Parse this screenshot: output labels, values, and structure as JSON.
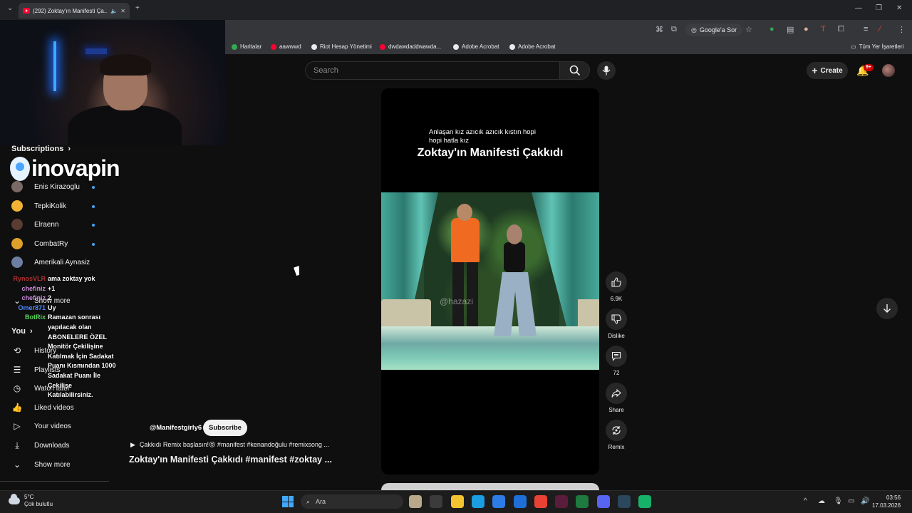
{
  "browser": {
    "tab_title": "(292) Zoktay'ın Manifesti Ça...",
    "ask_google": "Google'a Sor",
    "bookmarks": [
      {
        "label": "Haritalar",
        "color": "#34a853"
      },
      {
        "label": "aawwwd",
        "color": "#ff0033"
      },
      {
        "label": "Riot Hesap Yönetimi",
        "color": "#e8eaed"
      },
      {
        "label": "dwdawdaddwawda...",
        "color": "#ff0033"
      },
      {
        "label": "Adobe Acrobat",
        "color": "#e8eaed"
      },
      {
        "label": "Adobe Acrobat",
        "color": "#e8eaed"
      }
    ],
    "all_bookmarks": "Tüm Yer İşaretleri"
  },
  "overlay": {
    "logo_text": "inovapin"
  },
  "sidebar": {
    "subscriptions_label": "Subscriptions",
    "subscriptions": [
      {
        "name": "Enis Kirazoglu",
        "avatar_color": "#7a6a66",
        "new": true
      },
      {
        "name": "TepkiKolik",
        "avatar_color": "#f2b233",
        "new": true
      },
      {
        "name": "Elraenn",
        "avatar_color": "#5a3c33",
        "new": true
      },
      {
        "name": "CombatRy",
        "avatar_color": "#e0a12a",
        "new": true
      },
      {
        "name": "Amerikali Aynasiz",
        "avatar_color": "#6c7fa3",
        "new": false
      }
    ],
    "show_more_subs": "Show more",
    "you_label": "You",
    "you_items": [
      {
        "label": "History",
        "icon": "history-icon",
        "glyph": "⟲"
      },
      {
        "label": "Playlists",
        "icon": "playlists-icon",
        "glyph": "☰"
      },
      {
        "label": "Watch later",
        "icon": "clock-icon",
        "glyph": "◷"
      },
      {
        "label": "Liked videos",
        "icon": "thumbs-up-icon",
        "glyph": "👍"
      },
      {
        "label": "Your videos",
        "icon": "your-videos-icon",
        "glyph": "▷"
      },
      {
        "label": "Downloads",
        "icon": "download-icon",
        "glyph": "⤓"
      },
      {
        "label": "Show more",
        "icon": "chevron-down-icon",
        "glyph": "⌄"
      }
    ]
  },
  "chat": [
    {
      "user": "RynosVLR",
      "color": "#b03030",
      "message": "ama zoktay yok"
    },
    {
      "user": "chefiniz",
      "color": "#c98bd9",
      "message": "+1"
    },
    {
      "user": "chefiniz",
      "color": "#c98bd9",
      "message": "2"
    },
    {
      "user": "Omer871",
      "color": "#4f86ff",
      "message": "Uy"
    },
    {
      "user": "BotRix",
      "color": "#59d35c",
      "message": "Ramazan sonrası yapılacak olan ABONELERE ÖZEL Monitör Çekilişine Katılmak İçin Sadakat Puanı Kısmından 1000 Sadakat Puanı İle Çekilişe Katılabilirsiniz."
    }
  ],
  "header": {
    "search_placeholder": "Search",
    "create_label": "Create",
    "notifications_count": "9+"
  },
  "short": {
    "caption_small": "Anlaşan kız azıcık azıcık kıstın hopi hopi hatla kız",
    "caption_big": "Zoktay'ın Manifesti Çakkıdı",
    "watermark": "@hazazi",
    "channel": "@Manifestgirly6",
    "subscribe_label": "Subscribe",
    "description": "Çakkıdı Remix başlasın!😝 #manifest #kenandoğulu #remixsong ...",
    "title": "Zoktay'ın Manifesti Çakkıdı #manifest #zoktay ..."
  },
  "actions": {
    "like_count": "6.9K",
    "dislike_label": "Dislike",
    "comment_count": "72",
    "share_label": "Share",
    "remix_label": "Remix"
  },
  "taskbar": {
    "temperature": "5°C",
    "weather": "Çok bulutlu",
    "search_label": "Ara",
    "time": "03:56",
    "date": "17.03.2026",
    "apps": [
      {
        "name": "tb-landscape-widget",
        "color": "#b9a98a"
      },
      {
        "name": "tb-task-view",
        "color": "#3b3b3b"
      },
      {
        "name": "tb-file-explorer",
        "color": "#f4c430"
      },
      {
        "name": "tb-edge",
        "color": "#1b9de2"
      },
      {
        "name": "tb-store",
        "color": "#2d7be5"
      },
      {
        "name": "tb-outlook",
        "color": "#1f6fd6"
      },
      {
        "name": "tb-chrome",
        "color": "#e94235"
      },
      {
        "name": "tb-app-purple",
        "color": "#5a1c3a"
      },
      {
        "name": "tb-app-green",
        "color": "#1e7a3e"
      },
      {
        "name": "tb-discord",
        "color": "#5865f2"
      },
      {
        "name": "tb-steam",
        "color": "#2a475e"
      },
      {
        "name": "tb-app-teal",
        "color": "#17b26a"
      }
    ]
  }
}
